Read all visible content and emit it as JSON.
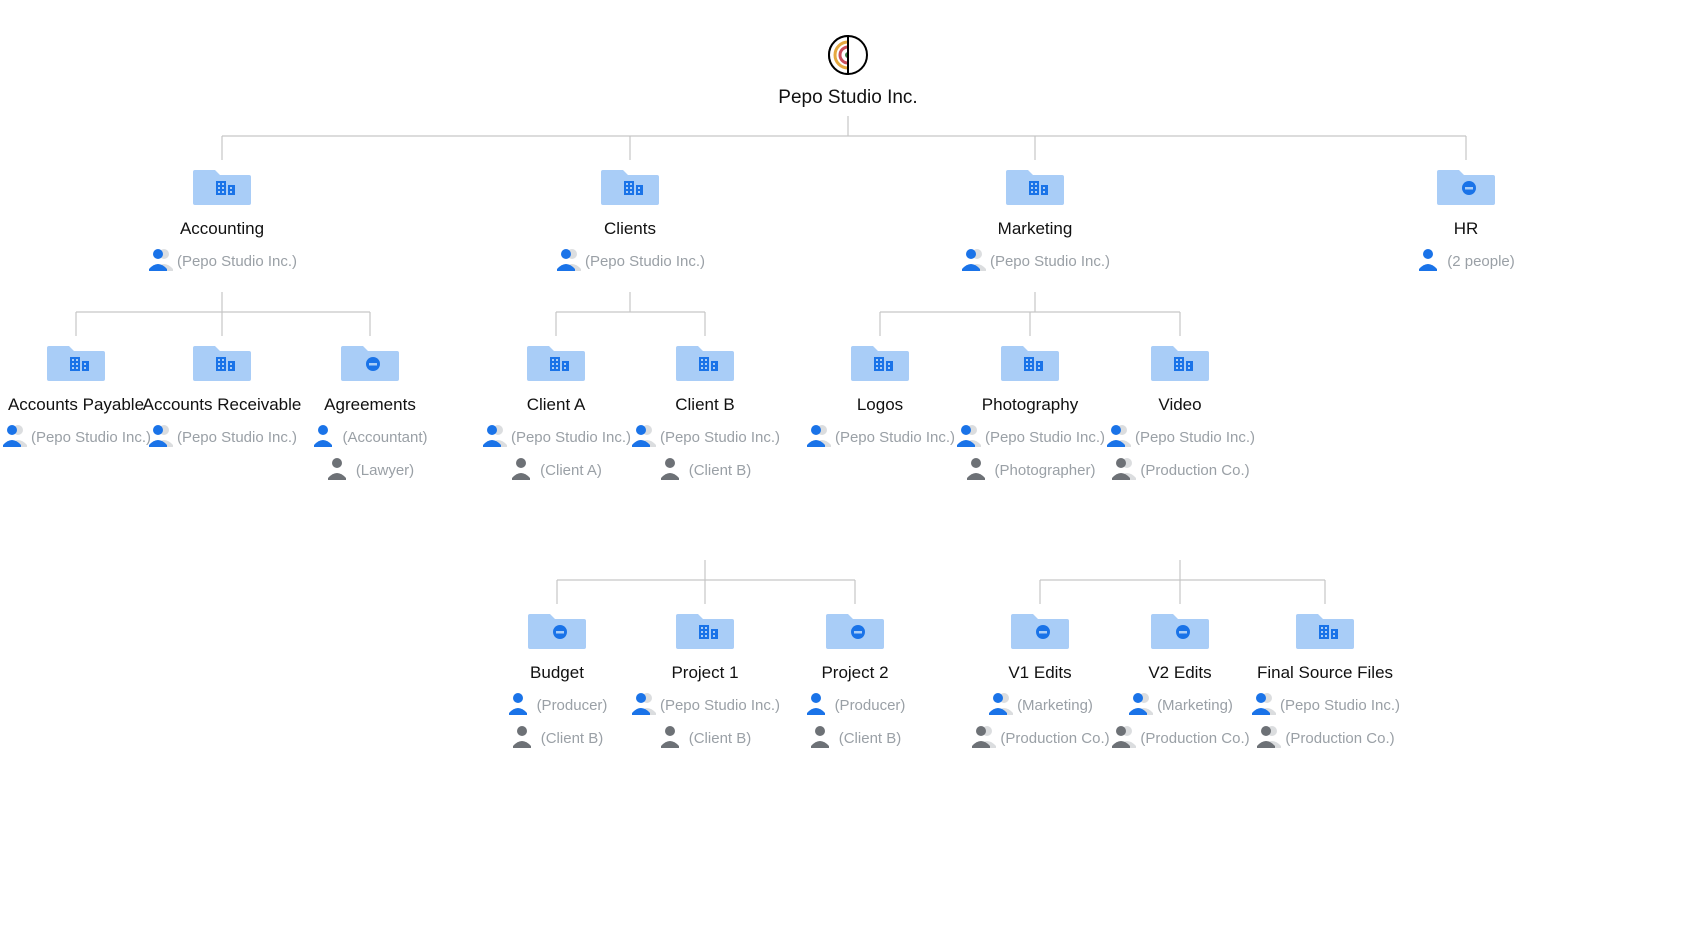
{
  "root": {
    "title": "Pepo Studio Inc."
  },
  "nodes": {
    "accounting": {
      "label": "Accounting",
      "shares": [
        {
          "kind": "group",
          "text": "(Pepo Studio Inc.)"
        }
      ],
      "folder": "building"
    },
    "clients": {
      "label": "Clients",
      "shares": [
        {
          "kind": "group",
          "text": "(Pepo Studio Inc.)"
        }
      ],
      "folder": "building"
    },
    "marketing": {
      "label": "Marketing",
      "shares": [
        {
          "kind": "group",
          "text": "(Pepo Studio Inc.)"
        }
      ],
      "folder": "building"
    },
    "hr": {
      "label": "HR",
      "shares": [
        {
          "kind": "person",
          "text": "(2 people)"
        }
      ],
      "folder": "minus"
    },
    "accounts_payable": {
      "label": "Accounts Payable",
      "shares": [
        {
          "kind": "group",
          "text": "(Pepo Studio Inc.)"
        }
      ],
      "folder": "building"
    },
    "accounts_receivable": {
      "label": "Accounts Receivable",
      "shares": [
        {
          "kind": "group",
          "text": "(Pepo Studio Inc.)"
        }
      ],
      "folder": "building"
    },
    "agreements": {
      "label": "Agreements",
      "shares": [
        {
          "kind": "person",
          "text": "(Accountant)"
        },
        {
          "kind": "person-gray",
          "text": "(Lawyer)"
        }
      ],
      "folder": "minus"
    },
    "client_a": {
      "label": "Client A",
      "shares": [
        {
          "kind": "group",
          "text": "(Pepo Studio Inc.)"
        },
        {
          "kind": "person-gray",
          "text": "(Client A)"
        }
      ],
      "folder": "building"
    },
    "client_b": {
      "label": "Client B",
      "shares": [
        {
          "kind": "group",
          "text": "(Pepo Studio Inc.)"
        },
        {
          "kind": "person-gray",
          "text": "(Client B)"
        }
      ],
      "folder": "building"
    },
    "logos": {
      "label": "Logos",
      "shares": [
        {
          "kind": "group",
          "text": "(Pepo Studio Inc.)"
        }
      ],
      "folder": "building"
    },
    "photography": {
      "label": "Photography",
      "shares": [
        {
          "kind": "group",
          "text": "(Pepo Studio Inc.)"
        },
        {
          "kind": "person-gray",
          "text": "(Photographer)"
        }
      ],
      "folder": "building"
    },
    "video": {
      "label": "Video",
      "shares": [
        {
          "kind": "group",
          "text": "(Pepo Studio Inc.)"
        },
        {
          "kind": "group-gray",
          "text": "(Production Co.)"
        }
      ],
      "folder": "building"
    },
    "budget": {
      "label": "Budget",
      "shares": [
        {
          "kind": "person",
          "text": "(Producer)"
        },
        {
          "kind": "person-gray",
          "text": "(Client B)"
        }
      ],
      "folder": "minus"
    },
    "project1": {
      "label": "Project 1",
      "shares": [
        {
          "kind": "group",
          "text": "(Pepo Studio Inc.)"
        },
        {
          "kind": "person-gray",
          "text": "(Client B)"
        }
      ],
      "folder": "building"
    },
    "project2": {
      "label": "Project 2",
      "shares": [
        {
          "kind": "person",
          "text": "(Producer)"
        },
        {
          "kind": "person-gray",
          "text": "(Client B)"
        }
      ],
      "folder": "minus"
    },
    "v1_edits": {
      "label": "V1 Edits",
      "shares": [
        {
          "kind": "group",
          "text": "(Marketing)"
        },
        {
          "kind": "group-gray",
          "text": "(Production Co.)"
        }
      ],
      "folder": "minus"
    },
    "v2_edits": {
      "label": "V2 Edits",
      "shares": [
        {
          "kind": "group",
          "text": "(Marketing)"
        },
        {
          "kind": "group-gray",
          "text": "(Production Co.)"
        }
      ],
      "folder": "minus"
    },
    "final_source_files": {
      "label": "Final Source Files",
      "shares": [
        {
          "kind": "group",
          "text": "(Pepo Studio Inc.)"
        },
        {
          "kind": "group-gray",
          "text": "(Production Co.)"
        }
      ],
      "folder": "building"
    }
  }
}
